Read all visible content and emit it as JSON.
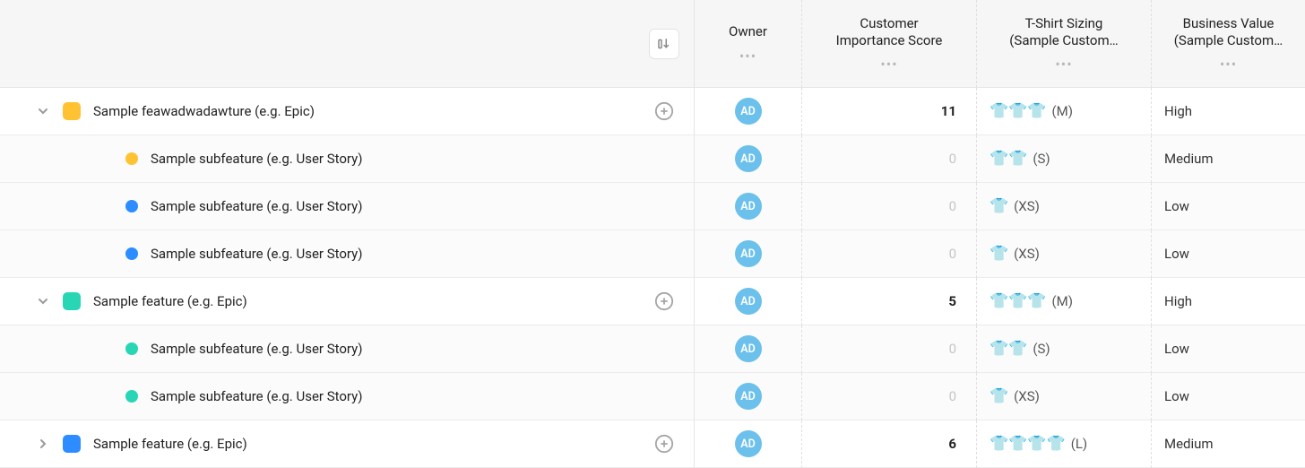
{
  "columns": {
    "owner": "Owner",
    "score": "Customer\nImportance Score",
    "tshirt": "T-Shirt Sizing\n(Sample Custom…",
    "biz": "Business Value\n(Sample Custom…"
  },
  "avatar_initials": "AD",
  "colors": {
    "yellow": "#ffc233",
    "blue": "#2d8cff",
    "teal": "#28d6b5",
    "brightblue": "#2d8cff"
  },
  "rows": [
    {
      "type": "parent",
      "expand": "down",
      "color": "yellow",
      "title": "Sample feawadwadawture (e.g. Epic)",
      "score": "11",
      "shirts": 3,
      "size_label": "(M)",
      "biz": "High"
    },
    {
      "type": "child",
      "color": "yellow",
      "title": "Sample subfeature (e.g. User Story)",
      "score": "0",
      "shirts": 2,
      "size_label": "(S)",
      "biz": "Medium"
    },
    {
      "type": "child",
      "color": "blue",
      "title": "Sample subfeature (e.g. User Story)",
      "score": "0",
      "shirts": 1,
      "size_label": "(XS)",
      "biz": "Low"
    },
    {
      "type": "child",
      "color": "blue",
      "title": "Sample subfeature (e.g. User Story)",
      "score": "0",
      "shirts": 1,
      "size_label": "(XS)",
      "biz": "Low"
    },
    {
      "type": "parent",
      "expand": "down",
      "color": "teal",
      "title": "Sample feature (e.g. Epic)",
      "score": "5",
      "shirts": 3,
      "size_label": "(M)",
      "biz": "High"
    },
    {
      "type": "child",
      "color": "teal",
      "title": "Sample subfeature (e.g. User Story)",
      "score": "0",
      "shirts": 2,
      "size_label": "(S)",
      "biz": "Low"
    },
    {
      "type": "child",
      "color": "teal",
      "title": "Sample subfeature (e.g. User Story)",
      "score": "0",
      "shirts": 1,
      "size_label": "(XS)",
      "biz": "Low"
    },
    {
      "type": "parent",
      "expand": "right",
      "color": "brightblue",
      "title": "Sample feature (e.g. Epic)",
      "score": "6",
      "shirts": 4,
      "size_label": "(L)",
      "biz": "Medium"
    }
  ]
}
